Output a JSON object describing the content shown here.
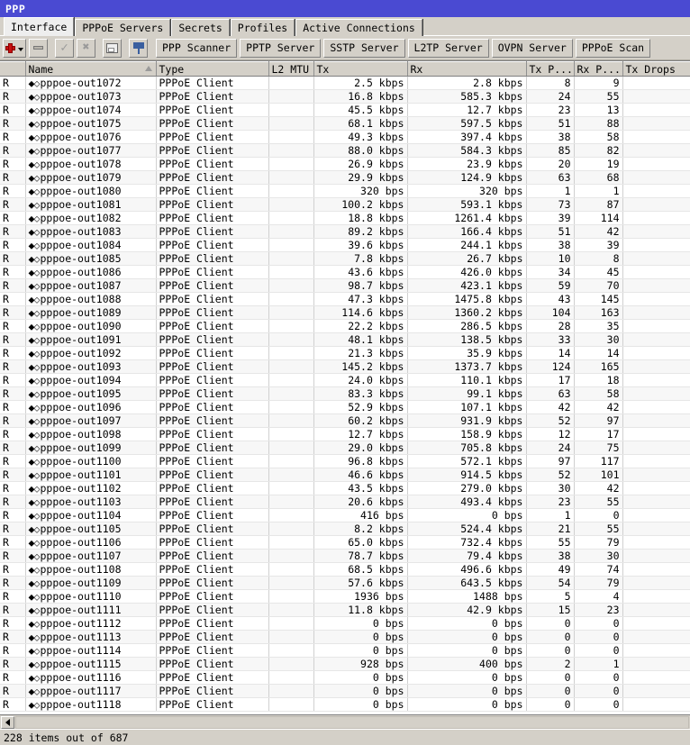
{
  "window": {
    "title": "PPP"
  },
  "tabs": [
    {
      "label": "Interface",
      "active": true
    },
    {
      "label": "PPPoE Servers",
      "active": false
    },
    {
      "label": "Secrets",
      "active": false
    },
    {
      "label": "Profiles",
      "active": false
    },
    {
      "label": "Active Connections",
      "active": false
    }
  ],
  "toolbar": {
    "icons": [
      {
        "name": "add-button",
        "icon": "plus-icon",
        "enabled": true
      },
      {
        "name": "remove-button",
        "icon": "minus-icon",
        "enabled": false
      },
      {
        "name": "enable-button",
        "icon": "check-icon",
        "enabled": false
      },
      {
        "name": "disable-button",
        "icon": "cross-icon",
        "enabled": false
      },
      {
        "name": "comment-button",
        "icon": "comment-icon",
        "enabled": true
      },
      {
        "name": "filter-button",
        "icon": "funnel-icon",
        "enabled": true
      }
    ],
    "buttons": [
      "PPP Scanner",
      "PPTP Server",
      "SSTP Server",
      "L2TP Server",
      "OVPN Server",
      "PPPoE Scan"
    ]
  },
  "table": {
    "columns": [
      {
        "key": "flag",
        "label": ""
      },
      {
        "key": "name",
        "label": "Name",
        "sorted": true
      },
      {
        "key": "type",
        "label": "Type"
      },
      {
        "key": "mtu",
        "label": "L2 MTU"
      },
      {
        "key": "tx",
        "label": "Tx"
      },
      {
        "key": "rx",
        "label": "Rx"
      },
      {
        "key": "txp",
        "label": "Tx P..."
      },
      {
        "key": "rxp",
        "label": "Rx P..."
      },
      {
        "key": "txd",
        "label": "Tx Drops"
      }
    ],
    "name_prefix": "⬥⬦",
    "rows": [
      {
        "flag": "R",
        "name": "pppoe-out1072",
        "type": "PPPoE Client",
        "mtu": "",
        "tx": "2.5 kbps",
        "rx": "2.8 kbps",
        "txp": "8",
        "rxp": "9",
        "txd": ""
      },
      {
        "flag": "R",
        "name": "pppoe-out1073",
        "type": "PPPoE Client",
        "mtu": "",
        "tx": "16.8 kbps",
        "rx": "585.3 kbps",
        "txp": "24",
        "rxp": "55",
        "txd": ""
      },
      {
        "flag": "R",
        "name": "pppoe-out1074",
        "type": "PPPoE Client",
        "mtu": "",
        "tx": "45.5 kbps",
        "rx": "12.7 kbps",
        "txp": "23",
        "rxp": "13",
        "txd": ""
      },
      {
        "flag": "R",
        "name": "pppoe-out1075",
        "type": "PPPoE Client",
        "mtu": "",
        "tx": "68.1 kbps",
        "rx": "597.5 kbps",
        "txp": "51",
        "rxp": "88",
        "txd": ""
      },
      {
        "flag": "R",
        "name": "pppoe-out1076",
        "type": "PPPoE Client",
        "mtu": "",
        "tx": "49.3 kbps",
        "rx": "397.4 kbps",
        "txp": "38",
        "rxp": "58",
        "txd": ""
      },
      {
        "flag": "R",
        "name": "pppoe-out1077",
        "type": "PPPoE Client",
        "mtu": "",
        "tx": "88.0 kbps",
        "rx": "584.3 kbps",
        "txp": "85",
        "rxp": "82",
        "txd": ""
      },
      {
        "flag": "R",
        "name": "pppoe-out1078",
        "type": "PPPoE Client",
        "mtu": "",
        "tx": "26.9 kbps",
        "rx": "23.9 kbps",
        "txp": "20",
        "rxp": "19",
        "txd": ""
      },
      {
        "flag": "R",
        "name": "pppoe-out1079",
        "type": "PPPoE Client",
        "mtu": "",
        "tx": "29.9 kbps",
        "rx": "124.9 kbps",
        "txp": "63",
        "rxp": "68",
        "txd": ""
      },
      {
        "flag": "R",
        "name": "pppoe-out1080",
        "type": "PPPoE Client",
        "mtu": "",
        "tx": "320 bps",
        "rx": "320 bps",
        "txp": "1",
        "rxp": "1",
        "txd": ""
      },
      {
        "flag": "R",
        "name": "pppoe-out1081",
        "type": "PPPoE Client",
        "mtu": "",
        "tx": "100.2 kbps",
        "rx": "593.1 kbps",
        "txp": "73",
        "rxp": "87",
        "txd": ""
      },
      {
        "flag": "R",
        "name": "pppoe-out1082",
        "type": "PPPoE Client",
        "mtu": "",
        "tx": "18.8 kbps",
        "rx": "1261.4 kbps",
        "txp": "39",
        "rxp": "114",
        "txd": ""
      },
      {
        "flag": "R",
        "name": "pppoe-out1083",
        "type": "PPPoE Client",
        "mtu": "",
        "tx": "89.2 kbps",
        "rx": "166.4 kbps",
        "txp": "51",
        "rxp": "42",
        "txd": ""
      },
      {
        "flag": "R",
        "name": "pppoe-out1084",
        "type": "PPPoE Client",
        "mtu": "",
        "tx": "39.6 kbps",
        "rx": "244.1 kbps",
        "txp": "38",
        "rxp": "39",
        "txd": ""
      },
      {
        "flag": "R",
        "name": "pppoe-out1085",
        "type": "PPPoE Client",
        "mtu": "",
        "tx": "7.8 kbps",
        "rx": "26.7 kbps",
        "txp": "10",
        "rxp": "8",
        "txd": ""
      },
      {
        "flag": "R",
        "name": "pppoe-out1086",
        "type": "PPPoE Client",
        "mtu": "",
        "tx": "43.6 kbps",
        "rx": "426.0 kbps",
        "txp": "34",
        "rxp": "45",
        "txd": ""
      },
      {
        "flag": "R",
        "name": "pppoe-out1087",
        "type": "PPPoE Client",
        "mtu": "",
        "tx": "98.7 kbps",
        "rx": "423.1 kbps",
        "txp": "59",
        "rxp": "70",
        "txd": ""
      },
      {
        "flag": "R",
        "name": "pppoe-out1088",
        "type": "PPPoE Client",
        "mtu": "",
        "tx": "47.3 kbps",
        "rx": "1475.8 kbps",
        "txp": "43",
        "rxp": "145",
        "txd": ""
      },
      {
        "flag": "R",
        "name": "pppoe-out1089",
        "type": "PPPoE Client",
        "mtu": "",
        "tx": "114.6 kbps",
        "rx": "1360.2 kbps",
        "txp": "104",
        "rxp": "163",
        "txd": ""
      },
      {
        "flag": "R",
        "name": "pppoe-out1090",
        "type": "PPPoE Client",
        "mtu": "",
        "tx": "22.2 kbps",
        "rx": "286.5 kbps",
        "txp": "28",
        "rxp": "35",
        "txd": ""
      },
      {
        "flag": "R",
        "name": "pppoe-out1091",
        "type": "PPPoE Client",
        "mtu": "",
        "tx": "48.1 kbps",
        "rx": "138.5 kbps",
        "txp": "33",
        "rxp": "30",
        "txd": ""
      },
      {
        "flag": "R",
        "name": "pppoe-out1092",
        "type": "PPPoE Client",
        "mtu": "",
        "tx": "21.3 kbps",
        "rx": "35.9 kbps",
        "txp": "14",
        "rxp": "14",
        "txd": ""
      },
      {
        "flag": "R",
        "name": "pppoe-out1093",
        "type": "PPPoE Client",
        "mtu": "",
        "tx": "145.2 kbps",
        "rx": "1373.7 kbps",
        "txp": "124",
        "rxp": "165",
        "txd": ""
      },
      {
        "flag": "R",
        "name": "pppoe-out1094",
        "type": "PPPoE Client",
        "mtu": "",
        "tx": "24.0 kbps",
        "rx": "110.1 kbps",
        "txp": "17",
        "rxp": "18",
        "txd": ""
      },
      {
        "flag": "R",
        "name": "pppoe-out1095",
        "type": "PPPoE Client",
        "mtu": "",
        "tx": "83.3 kbps",
        "rx": "99.1 kbps",
        "txp": "63",
        "rxp": "58",
        "txd": ""
      },
      {
        "flag": "R",
        "name": "pppoe-out1096",
        "type": "PPPoE Client",
        "mtu": "",
        "tx": "52.9 kbps",
        "rx": "107.1 kbps",
        "txp": "42",
        "rxp": "42",
        "txd": ""
      },
      {
        "flag": "R",
        "name": "pppoe-out1097",
        "type": "PPPoE Client",
        "mtu": "",
        "tx": "60.2 kbps",
        "rx": "931.9 kbps",
        "txp": "52",
        "rxp": "97",
        "txd": ""
      },
      {
        "flag": "R",
        "name": "pppoe-out1098",
        "type": "PPPoE Client",
        "mtu": "",
        "tx": "12.7 kbps",
        "rx": "158.9 kbps",
        "txp": "12",
        "rxp": "17",
        "txd": ""
      },
      {
        "flag": "R",
        "name": "pppoe-out1099",
        "type": "PPPoE Client",
        "mtu": "",
        "tx": "29.0 kbps",
        "rx": "705.8 kbps",
        "txp": "24",
        "rxp": "75",
        "txd": ""
      },
      {
        "flag": "R",
        "name": "pppoe-out1100",
        "type": "PPPoE Client",
        "mtu": "",
        "tx": "96.8 kbps",
        "rx": "572.1 kbps",
        "txp": "97",
        "rxp": "117",
        "txd": ""
      },
      {
        "flag": "R",
        "name": "pppoe-out1101",
        "type": "PPPoE Client",
        "mtu": "",
        "tx": "46.6 kbps",
        "rx": "914.5 kbps",
        "txp": "52",
        "rxp": "101",
        "txd": ""
      },
      {
        "flag": "R",
        "name": "pppoe-out1102",
        "type": "PPPoE Client",
        "mtu": "",
        "tx": "43.5 kbps",
        "rx": "279.0 kbps",
        "txp": "30",
        "rxp": "42",
        "txd": ""
      },
      {
        "flag": "R",
        "name": "pppoe-out1103",
        "type": "PPPoE Client",
        "mtu": "",
        "tx": "20.6 kbps",
        "rx": "493.4 kbps",
        "txp": "23",
        "rxp": "55",
        "txd": ""
      },
      {
        "flag": "R",
        "name": "pppoe-out1104",
        "type": "PPPoE Client",
        "mtu": "",
        "tx": "416 bps",
        "rx": "0 bps",
        "txp": "1",
        "rxp": "0",
        "txd": ""
      },
      {
        "flag": "R",
        "name": "pppoe-out1105",
        "type": "PPPoE Client",
        "mtu": "",
        "tx": "8.2 kbps",
        "rx": "524.4 kbps",
        "txp": "21",
        "rxp": "55",
        "txd": ""
      },
      {
        "flag": "R",
        "name": "pppoe-out1106",
        "type": "PPPoE Client",
        "mtu": "",
        "tx": "65.0 kbps",
        "rx": "732.4 kbps",
        "txp": "55",
        "rxp": "79",
        "txd": ""
      },
      {
        "flag": "R",
        "name": "pppoe-out1107",
        "type": "PPPoE Client",
        "mtu": "",
        "tx": "78.7 kbps",
        "rx": "79.4 kbps",
        "txp": "38",
        "rxp": "30",
        "txd": ""
      },
      {
        "flag": "R",
        "name": "pppoe-out1108",
        "type": "PPPoE Client",
        "mtu": "",
        "tx": "68.5 kbps",
        "rx": "496.6 kbps",
        "txp": "49",
        "rxp": "74",
        "txd": ""
      },
      {
        "flag": "R",
        "name": "pppoe-out1109",
        "type": "PPPoE Client",
        "mtu": "",
        "tx": "57.6 kbps",
        "rx": "643.5 kbps",
        "txp": "54",
        "rxp": "79",
        "txd": ""
      },
      {
        "flag": "R",
        "name": "pppoe-out1110",
        "type": "PPPoE Client",
        "mtu": "",
        "tx": "1936 bps",
        "rx": "1488 bps",
        "txp": "5",
        "rxp": "4",
        "txd": ""
      },
      {
        "flag": "R",
        "name": "pppoe-out1111",
        "type": "PPPoE Client",
        "mtu": "",
        "tx": "11.8 kbps",
        "rx": "42.9 kbps",
        "txp": "15",
        "rxp": "23",
        "txd": ""
      },
      {
        "flag": "R",
        "name": "pppoe-out1112",
        "type": "PPPoE Client",
        "mtu": "",
        "tx": "0 bps",
        "rx": "0 bps",
        "txp": "0",
        "rxp": "0",
        "txd": ""
      },
      {
        "flag": "R",
        "name": "pppoe-out1113",
        "type": "PPPoE Client",
        "mtu": "",
        "tx": "0 bps",
        "rx": "0 bps",
        "txp": "0",
        "rxp": "0",
        "txd": ""
      },
      {
        "flag": "R",
        "name": "pppoe-out1114",
        "type": "PPPoE Client",
        "mtu": "",
        "tx": "0 bps",
        "rx": "0 bps",
        "txp": "0",
        "rxp": "0",
        "txd": ""
      },
      {
        "flag": "R",
        "name": "pppoe-out1115",
        "type": "PPPoE Client",
        "mtu": "",
        "tx": "928 bps",
        "rx": "400 bps",
        "txp": "2",
        "rxp": "1",
        "txd": ""
      },
      {
        "flag": "R",
        "name": "pppoe-out1116",
        "type": "PPPoE Client",
        "mtu": "",
        "tx": "0 bps",
        "rx": "0 bps",
        "txp": "0",
        "rxp": "0",
        "txd": ""
      },
      {
        "flag": "R",
        "name": "pppoe-out1117",
        "type": "PPPoE Client",
        "mtu": "",
        "tx": "0 bps",
        "rx": "0 bps",
        "txp": "0",
        "rxp": "0",
        "txd": ""
      },
      {
        "flag": "R",
        "name": "pppoe-out1118",
        "type": "PPPoE Client",
        "mtu": "",
        "tx": "0 bps",
        "rx": "0 bps",
        "txp": "0",
        "rxp": "0",
        "txd": ""
      }
    ]
  },
  "statusbar": {
    "text": "228 items out of 687"
  },
  "colors": {
    "titlebar": "#4a4ad2",
    "chrome": "#d4d0c8",
    "grid_line": "#d0d0d0",
    "accent_red": "#c81010"
  }
}
